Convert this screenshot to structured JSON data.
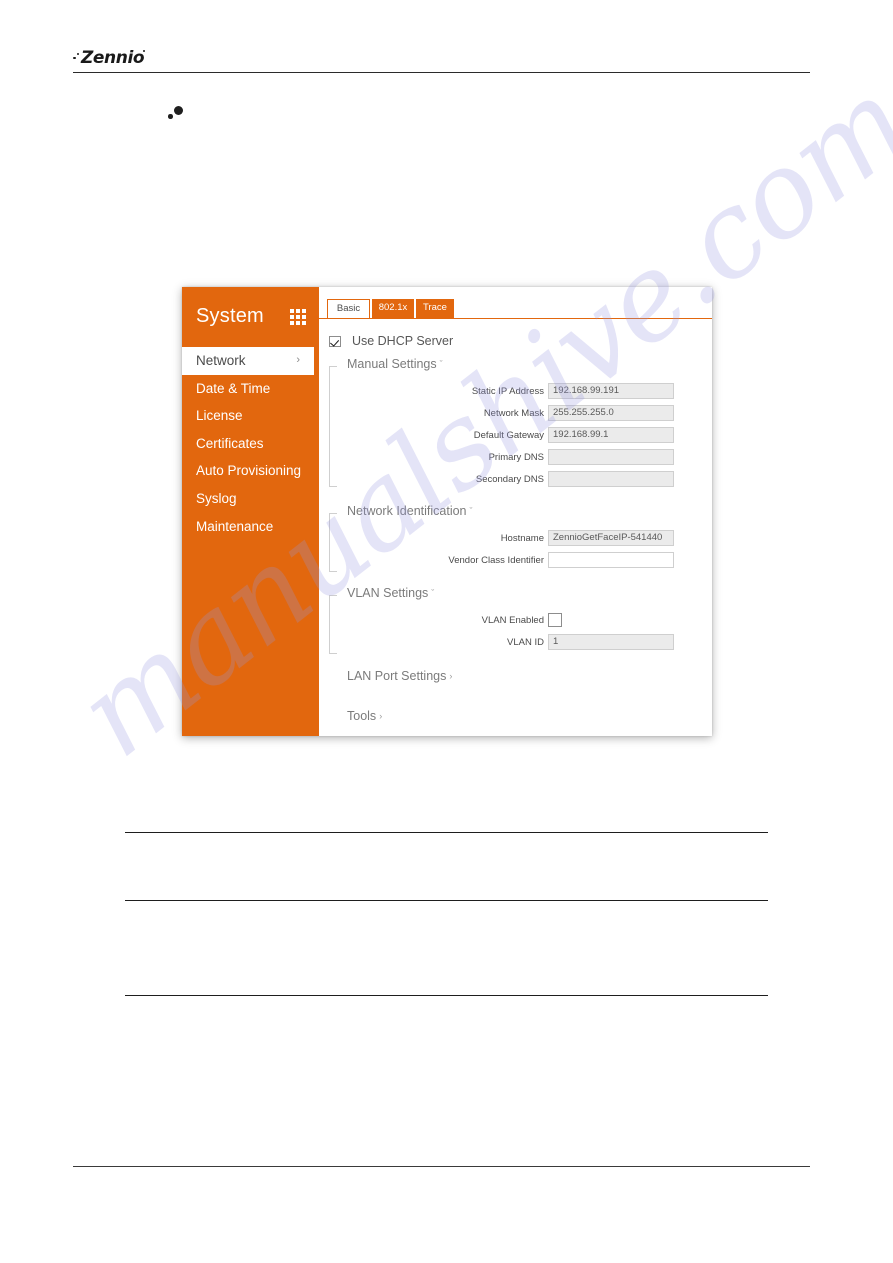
{
  "page": {
    "brand": "Zennio",
    "brand_logo_dots_icon": "zennio-dots-icon",
    "bullet_icon": "two-dot-bullet-icon"
  },
  "ui": {
    "sidebar": {
      "title": "System",
      "grid_icon": "grid-apps-icon",
      "items": [
        {
          "label": "Network",
          "active": true,
          "chevron": "›"
        },
        {
          "label": "Date & Time",
          "active": false,
          "chevron": ""
        },
        {
          "label": "License",
          "active": false,
          "chevron": ""
        },
        {
          "label": "Certificates",
          "active": false,
          "chevron": ""
        },
        {
          "label": "Auto Provisioning",
          "active": false,
          "chevron": ""
        },
        {
          "label": "Syslog",
          "active": false,
          "chevron": ""
        },
        {
          "label": "Maintenance",
          "active": false,
          "chevron": ""
        }
      ]
    },
    "tabs": [
      {
        "label": "Basic",
        "active": true
      },
      {
        "label": "802.1x",
        "active": false
      },
      {
        "label": "Trace",
        "active": false
      }
    ],
    "dhcp": {
      "label": "Use DHCP Server",
      "checked": true
    },
    "sections": {
      "manual_settings": {
        "title": "Manual Settings",
        "caret": "ˇ",
        "fields": [
          {
            "label": "Static IP Address",
            "value": "192.168.99.191",
            "disabled": true
          },
          {
            "label": "Network Mask",
            "value": "255.255.255.0",
            "disabled": true
          },
          {
            "label": "Default Gateway",
            "value": "192.168.99.1",
            "disabled": true
          },
          {
            "label": "Primary DNS",
            "value": "",
            "disabled": true
          },
          {
            "label": "Secondary DNS",
            "value": "",
            "disabled": true
          }
        ]
      },
      "network_identification": {
        "title": "Network Identification",
        "caret": "ˇ",
        "fields": [
          {
            "label": "Hostname",
            "value": "ZennioGetFaceIP-541440",
            "disabled": true
          },
          {
            "label": "Vendor Class Identifier",
            "value": "",
            "disabled": false
          }
        ]
      },
      "vlan_settings": {
        "title": "VLAN Settings",
        "caret": "ˇ",
        "enabled_label": "VLAN Enabled",
        "enabled_checked": false,
        "id_label": "VLAN ID",
        "id_value": "1"
      },
      "lan_port_settings": {
        "title": "LAN Port Settings",
        "caret": "›"
      },
      "tools": {
        "title": "Tools",
        "caret": "›"
      }
    },
    "colors": {
      "brand_orange": "#e2670e",
      "field_bg": "#ebebeb",
      "field_border": "#cfcfcf",
      "label_gray": "#4a4a4a",
      "section_gray": "#7b7b7b"
    }
  },
  "watermark": {
    "text": "manualshive.com"
  }
}
